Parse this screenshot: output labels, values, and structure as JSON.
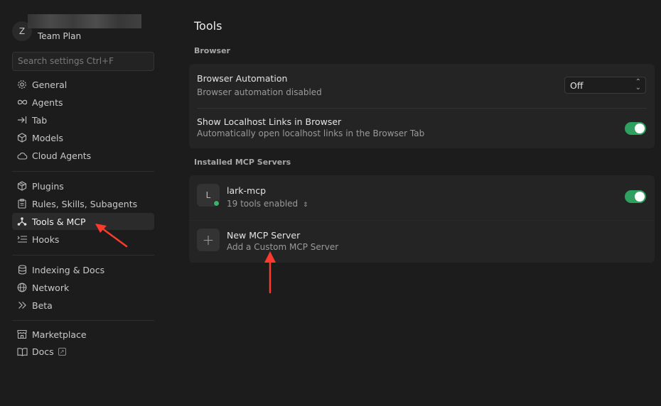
{
  "account": {
    "avatar_letter": "Z",
    "plan": "Team Plan"
  },
  "search": {
    "placeholder": "Search settings Ctrl+F"
  },
  "sidebar": {
    "groups": [
      [
        {
          "label": "General",
          "icon": "gear-icon"
        },
        {
          "label": "Agents",
          "icon": "infinity-icon"
        },
        {
          "label": "Tab",
          "icon": "tab-arrow-icon"
        },
        {
          "label": "Models",
          "icon": "cube-icon"
        },
        {
          "label": "Cloud Agents",
          "icon": "cloud-icon"
        }
      ],
      [
        {
          "label": "Plugins",
          "icon": "package-icon"
        },
        {
          "label": "Rules, Skills, Subagents",
          "icon": "clipboard-icon"
        },
        {
          "label": "Tools & MCP",
          "icon": "nodes-icon",
          "active": true
        },
        {
          "label": "Hooks",
          "icon": "list-icon"
        }
      ],
      [
        {
          "label": "Indexing & Docs",
          "icon": "database-icon"
        },
        {
          "label": "Network",
          "icon": "globe-icon"
        },
        {
          "label": "Beta",
          "icon": "chevrons-right-icon"
        }
      ],
      [
        {
          "label": "Marketplace",
          "icon": "store-icon"
        },
        {
          "label": "Docs",
          "icon": "book-icon",
          "external": true
        }
      ]
    ]
  },
  "main": {
    "title": "Tools",
    "browser_section": "Browser",
    "browser_automation": {
      "title": "Browser Automation",
      "subtitle": "Browser automation disabled",
      "select_value": "Off"
    },
    "localhost_links": {
      "title": "Show Localhost Links in Browser",
      "subtitle": "Automatically open localhost links in the Browser Tab",
      "enabled": true
    },
    "mcp_section": "Installed MCP Servers",
    "servers": [
      {
        "letter": "L",
        "name": "lark-mcp",
        "tools": "19 tools enabled",
        "enabled": true,
        "status_color": "#3ab26b"
      }
    ],
    "new_server": {
      "title": "New MCP Server",
      "subtitle": "Add a Custom MCP Server"
    }
  },
  "colors": {
    "accent": "#2fa060",
    "annotation_arrow": "#ff3b30"
  }
}
